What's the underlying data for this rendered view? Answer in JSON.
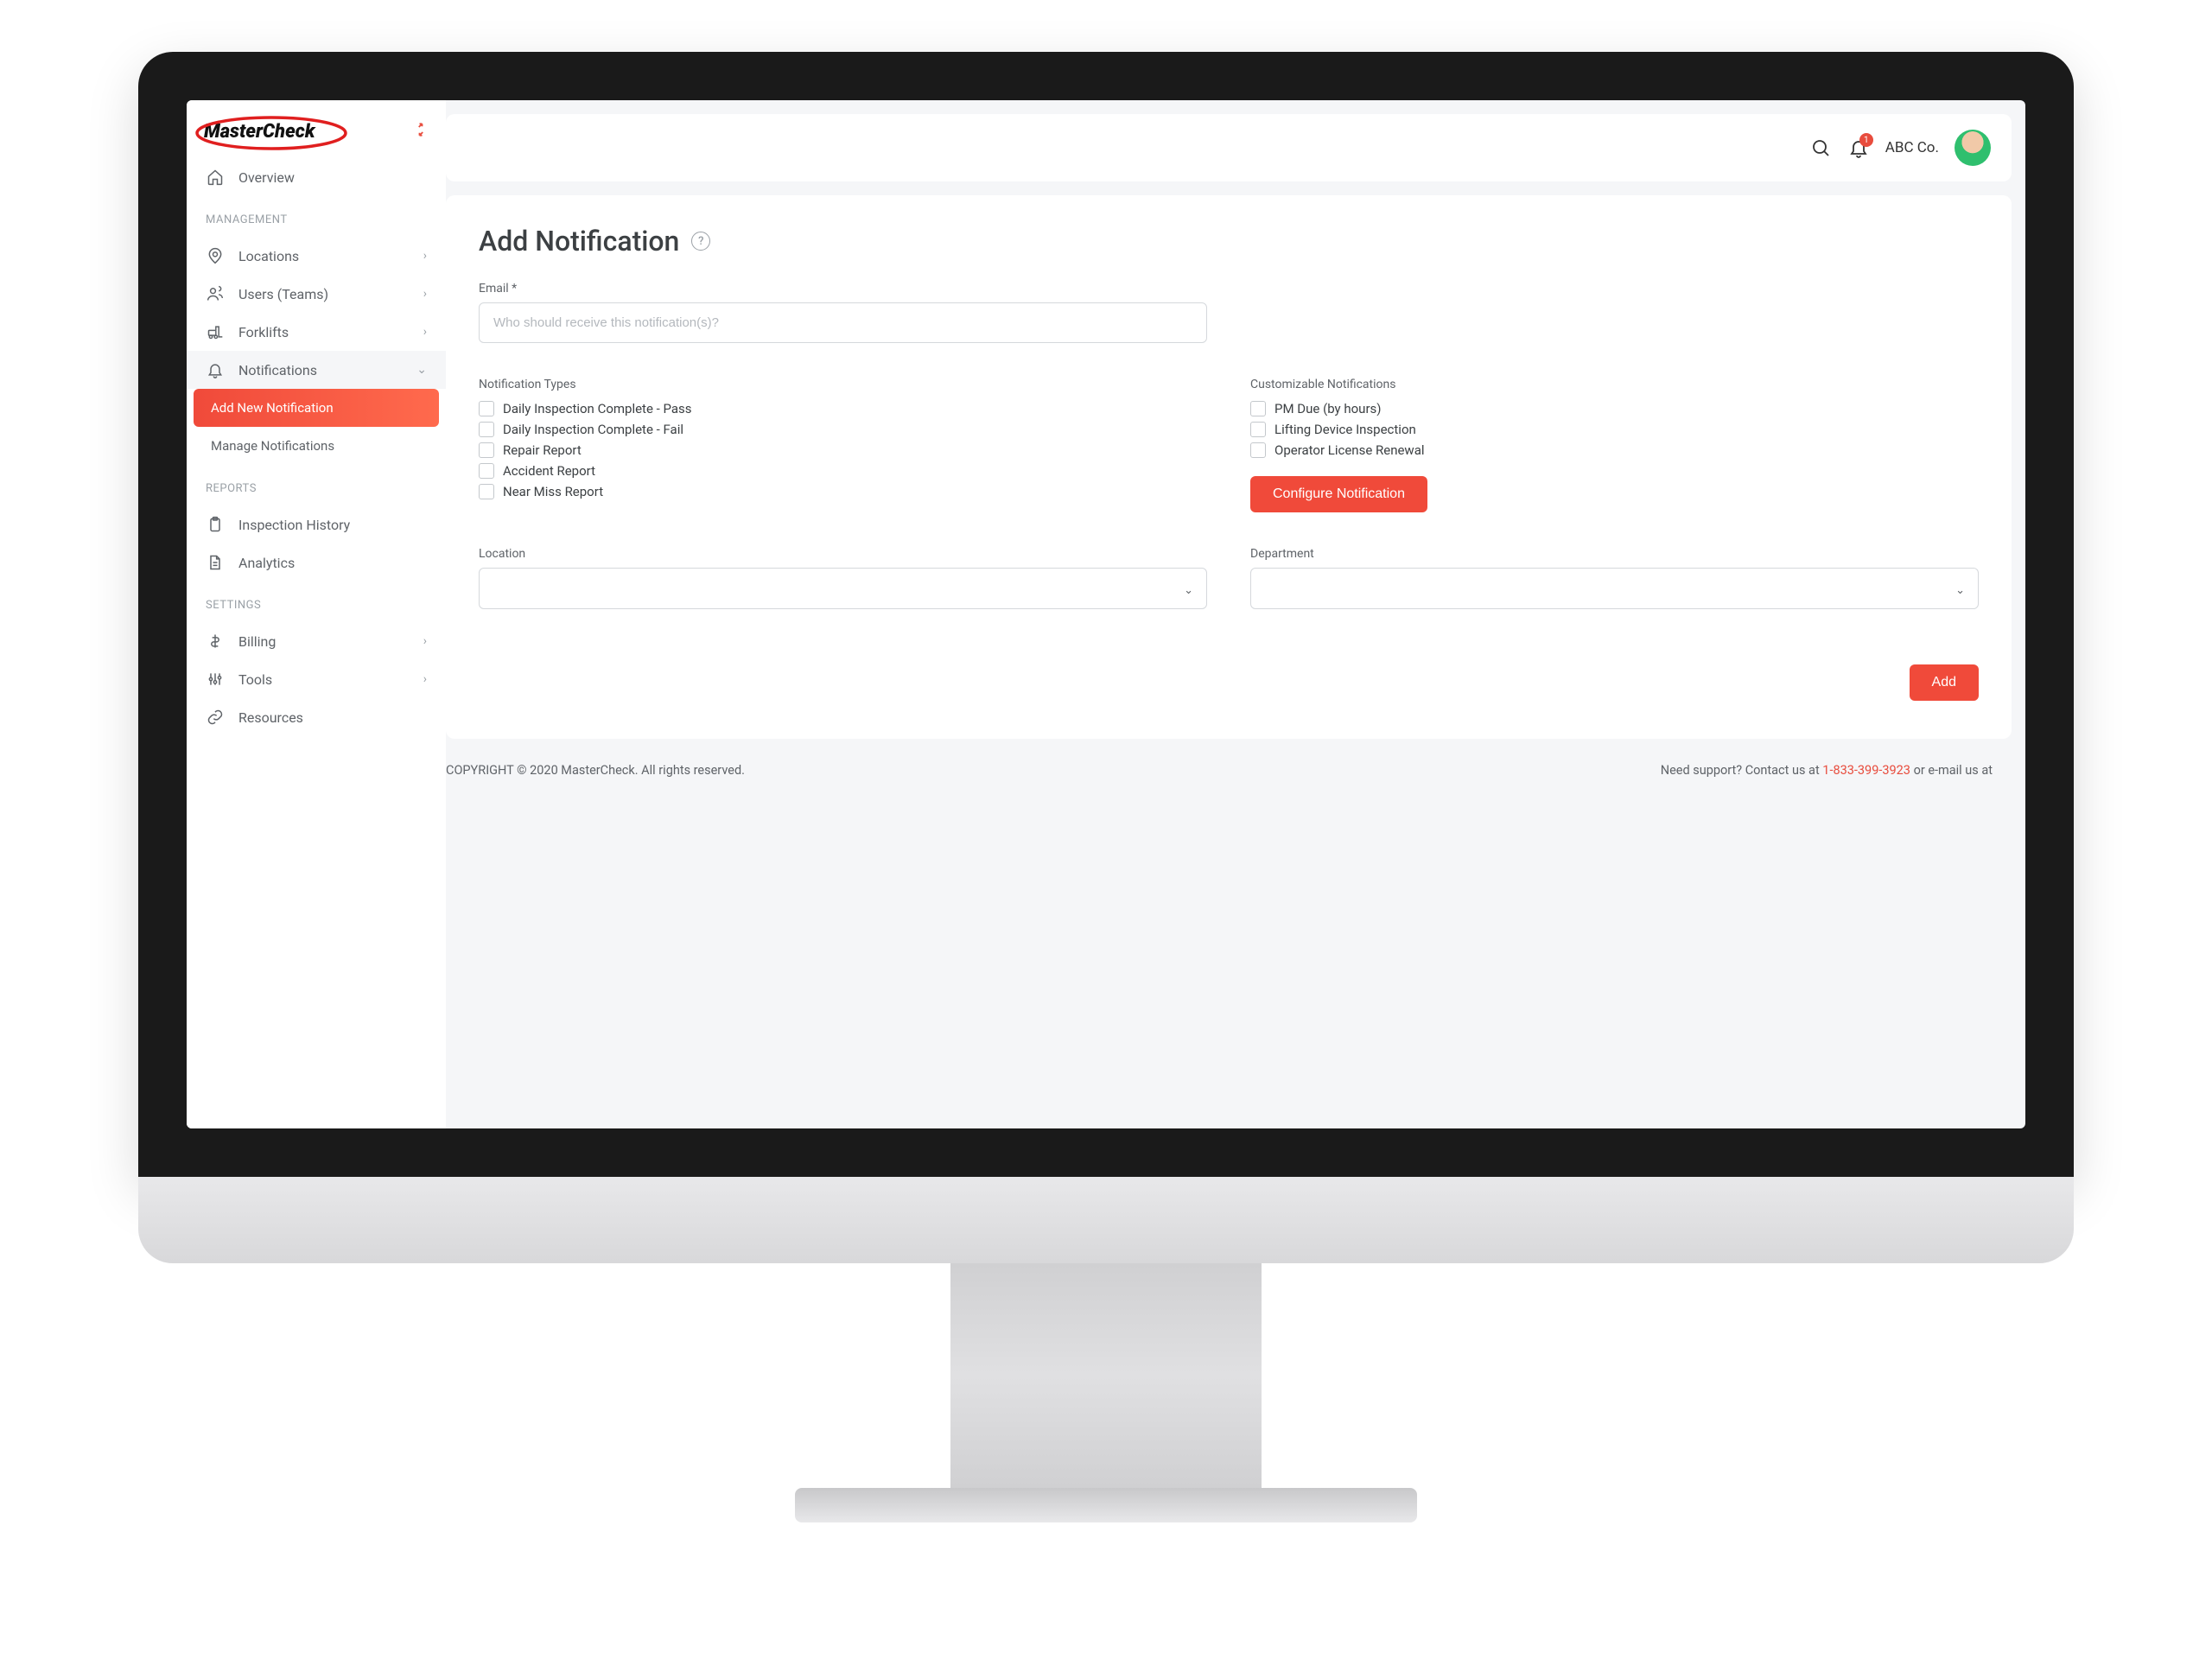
{
  "brand": {
    "name": "MasterCheck"
  },
  "header": {
    "company": "ABC Co.",
    "notification_count": "1"
  },
  "sidebar": {
    "overview": "Overview",
    "sections": {
      "management": "MANAGEMENT",
      "reports": "REPORTS",
      "settings": "SETTINGS"
    },
    "items": {
      "locations": "Locations",
      "users": "Users (Teams)",
      "forklifts": "Forklifts",
      "notifications": "Notifications",
      "add_notification": "Add New Notification",
      "manage_notifications": "Manage Notifications",
      "inspection_history": "Inspection History",
      "analytics": "Analytics",
      "billing": "Billing",
      "tools": "Tools",
      "resources": "Resources"
    }
  },
  "page": {
    "title": "Add Notification",
    "email_label": "Email *",
    "email_placeholder": "Who should receive this notification(s)?",
    "notification_types_label": "Notification Types",
    "customizable_label": "Customizable Notifications",
    "location_label": "Location",
    "department_label": "Department",
    "configure_btn": "Configure Notification",
    "add_btn": "Add",
    "types": {
      "t0": "Daily Inspection Complete - Pass",
      "t1": "Daily Inspection Complete - Fail",
      "t2": "Repair Report",
      "t3": "Accident Report",
      "t4": "Near Miss Report"
    },
    "custom": {
      "c0": "PM Due (by hours)",
      "c1": "Lifting Device Inspection",
      "c2": "Operator License Renewal"
    }
  },
  "footer": {
    "copyright": "COPYRIGHT © 2020 MasterCheck. All rights reserved.",
    "support_prefix": "Need support? Contact us at ",
    "phone": "1-833-399-3923",
    "support_suffix": " or e-mail us at"
  }
}
